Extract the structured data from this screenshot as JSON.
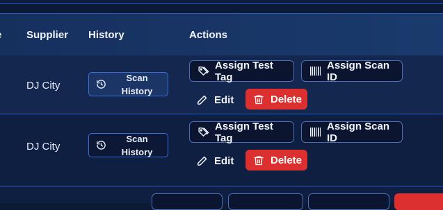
{
  "table": {
    "headers": {
      "supplier": "Supplier",
      "history": "History",
      "actions": "Actions"
    },
    "rows": [
      {
        "supplier": "DJ City",
        "history_line1": "Scan",
        "history_line2": "History",
        "assign_test_tag": "Assign Test Tag",
        "assign_scan_id": "Assign Scan ID",
        "edit": "Edit",
        "delete": "Delete"
      },
      {
        "supplier": "DJ City",
        "history_line1": "Scan",
        "history_line2": "History",
        "assign_test_tag": "Assign Test Tag",
        "assign_scan_id": "Assign Scan ID",
        "edit": "Edit",
        "delete": "Delete"
      }
    ]
  },
  "colors": {
    "accent": "#2b59c7",
    "danger": "#dc2f2f",
    "background": "#0d1a36"
  }
}
